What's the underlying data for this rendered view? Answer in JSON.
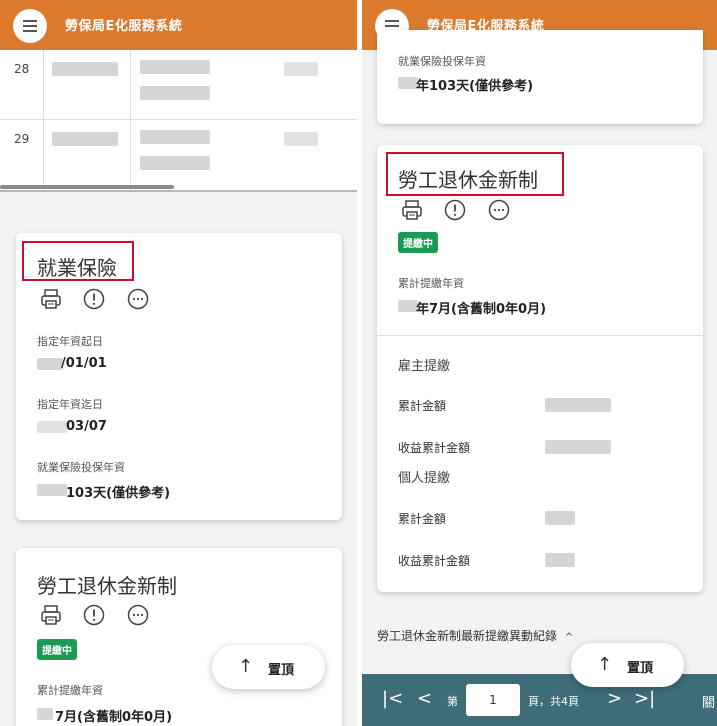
{
  "app": {
    "title": "勞保局E化服務系統"
  },
  "left": {
    "table_rows": [
      {
        "no": "28"
      },
      {
        "no": "29"
      }
    ],
    "employment_card": {
      "title": "就業保險",
      "fields": [
        {
          "label": "指定年資起日",
          "value": "/01/01"
        },
        {
          "label": "指定年資迄日",
          "value": "03/07"
        },
        {
          "label": "就業保險投保年資",
          "value": "103天(僅供參考)"
        }
      ]
    },
    "pension_card": {
      "title": "勞工退休金新制",
      "badge": "提繳中",
      "field_label": "累計提繳年資",
      "field_value": "7月(含舊制0年0月)"
    },
    "top_button": "置頂"
  },
  "right": {
    "prev_label": "就業保險投保年資",
    "prev_value": "年103天(僅供參考)",
    "pension_card": {
      "title": "勞工退休金新制",
      "badge": "提繳中",
      "field_label": "累計提繳年資",
      "field_value": "年7月(含舊制0年0月)",
      "employer_section": "雇主提繳",
      "employer_rows": [
        {
          "label": "累計金額"
        },
        {
          "label": "收益累計金額"
        }
      ],
      "personal_section": "個人提繳",
      "personal_rows": [
        {
          "label": "累計金額"
        },
        {
          "label": "收益累計金額"
        }
      ]
    },
    "history_link": "勞工退休金新制最新提繳異動紀錄",
    "history_chevron": "^",
    "top_button": "置頂",
    "pagination": {
      "first_icon": "|<",
      "prev_icon": "<",
      "page_prefix": "第",
      "page_value": "1",
      "page_suffix": "頁，共4頁",
      "next_icon": ">",
      "last_icon": ">|",
      "close_partial": "關"
    }
  }
}
